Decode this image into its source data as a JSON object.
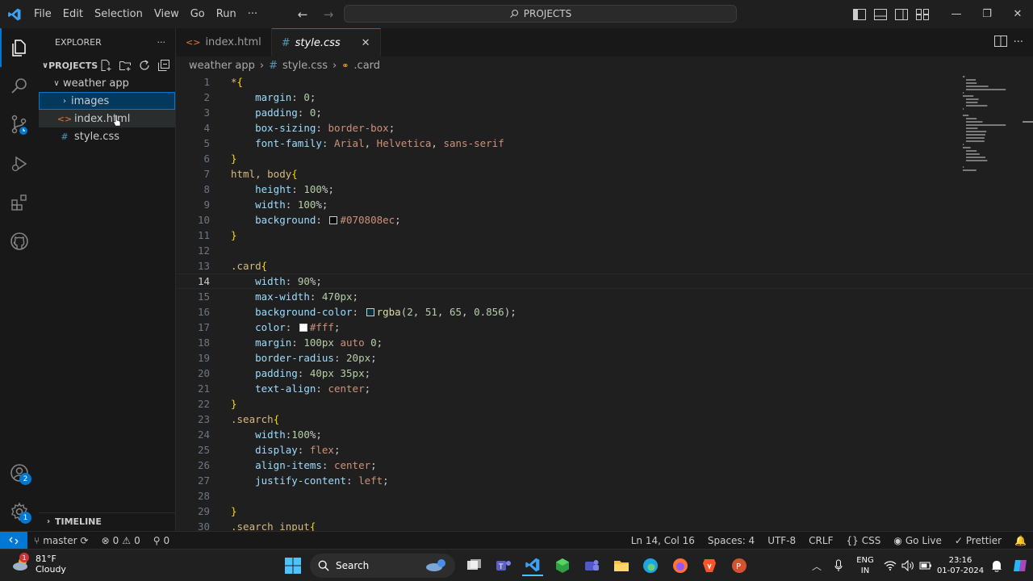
{
  "menu": [
    "File",
    "Edit",
    "Selection",
    "View",
    "Go",
    "Run",
    "···"
  ],
  "command_center": "PROJECTS",
  "sidebar": {
    "header": "EXPLORER",
    "header_more": "···",
    "section": "PROJECTS",
    "folder": "weather app",
    "items": [
      {
        "label": "images",
        "kind": "folder"
      },
      {
        "label": "index.html",
        "kind": "html"
      },
      {
        "label": "style.css",
        "kind": "css"
      }
    ],
    "timeline": "TIMELINE"
  },
  "tabs": [
    {
      "label": "index.html",
      "icon": "<>"
    },
    {
      "label": "style.css",
      "icon": "#",
      "close": "✕"
    }
  ],
  "breadcrumb": {
    "folder": "weather app",
    "file": "style.css",
    "symbol": ".card"
  },
  "code_lines": [
    "*{",
    "    margin: 0;",
    "    padding: 0;",
    "    box-sizing: border-box;",
    "    font-family: Arial, Helvetica, sans-serif",
    "}",
    "html, body{",
    "    height: 100%;",
    "    width: 100%;",
    "    background: #070808ec;",
    "}",
    "",
    ".card{",
    "    width: 90%;",
    "    max-width: 470px;",
    "    background-color: rgba(2, 51, 65, 0.856);",
    "    color: #fff;",
    "    margin: 100px auto 0;",
    "    border-radius: 20px;",
    "    padding: 40px 35px;",
    "    text-align: center;",
    "}",
    ".search{",
    "    width:100%;",
    "    display: flex;",
    "    align-items: center;",
    "    justify-content: left;",
    "",
    "}",
    ".search input{"
  ],
  "current_line": 14,
  "activity_badges": {
    "accounts": "2",
    "manage": "1"
  },
  "statusbar": {
    "branch": "master",
    "errors": "0",
    "warnings": "0",
    "ports": "0",
    "position": "Ln 14, Col 16",
    "spaces": "Spaces: 4",
    "encoding": "UTF-8",
    "eol": "CRLF",
    "language": "CSS",
    "golive": "Go Live",
    "prettier": "Prettier"
  },
  "taskbar": {
    "weather_temp": "81°F",
    "weather_desc": "Cloudy",
    "weather_badge": "1",
    "search": "Search",
    "lang_top": "ENG",
    "lang_bottom": "IN",
    "time": "23:16",
    "date": "01-07-2024"
  },
  "colors": {
    "accent": "#0078d4",
    "editor_bg": "#1f1f1f",
    "sidebar_bg": "#181818"
  }
}
